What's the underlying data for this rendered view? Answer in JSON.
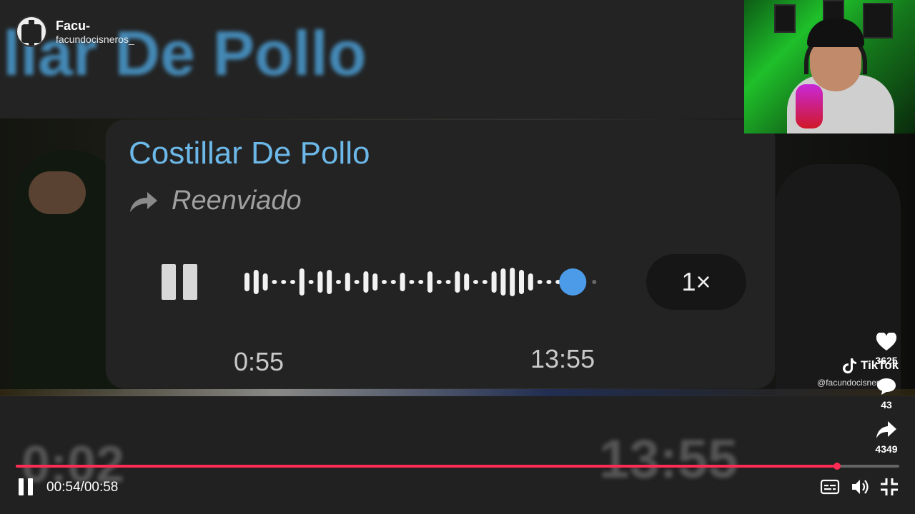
{
  "profile": {
    "name": "Facu-",
    "handle": "facundocisneros_"
  },
  "background": {
    "ghost_title": "llar De Pollo",
    "ghost_time_start": "0:02",
    "ghost_time_end": "13:55"
  },
  "voice_message": {
    "title": "Costillar De Pollo",
    "forwarded_label": "Reenviado",
    "speed": "1×",
    "current_time": "0:55",
    "duration": "13:55",
    "played_fraction": 0.94
  },
  "side_actions": {
    "likes": "3625",
    "comments": "43",
    "shares": "4349"
  },
  "watermark": {
    "brand": "TikTok",
    "handle": "@facundocisneros_"
  },
  "player": {
    "time_display": "00:54/00:58",
    "progress_fraction": 0.93
  },
  "colors": {
    "accent": "#fe2c55",
    "title_blue": "#6cb8e8",
    "wave_dot": "#4c9be8"
  },
  "icons": [
    "pause-icon",
    "forward-arrow-icon",
    "heart-icon",
    "comment-icon",
    "share-icon",
    "tiktok-logo-icon",
    "captions-icon",
    "volume-icon",
    "exit-fullscreen-icon"
  ]
}
